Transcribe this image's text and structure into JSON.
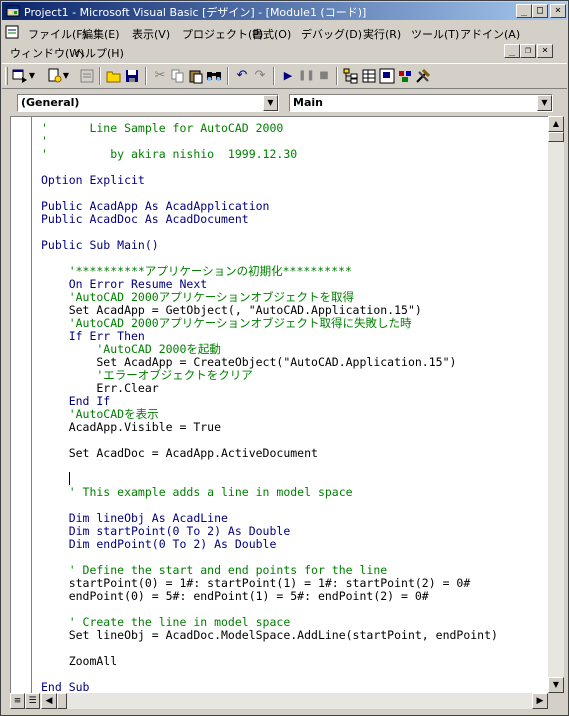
{
  "window": {
    "title": "Project1 - Microsoft Visual Basic [デザイン] - [Module1 (コード)]",
    "minimize_glyph": "_",
    "maximize_glyph": "□",
    "close_glyph": "×"
  },
  "menu": {
    "row1": [
      "ファイル(F)",
      "編集(E)",
      "表示(V)",
      "プロジェクト(P)",
      "書式(O)",
      "デバッグ(D)",
      "実行(R)",
      "ツール(T)",
      "アドイン(A)"
    ],
    "row2": [
      "ウィンドウ(W)",
      "ヘルプ(H)"
    ]
  },
  "combos": {
    "object": "(General)",
    "procedure": "Main"
  },
  "code": [
    {
      "text": "'      Line Sample for AutoCAD 2000",
      "kind": "cm"
    },
    {
      "text": "'",
      "kind": "cm"
    },
    {
      "text": "'         by akira nishio  1999.12.30",
      "kind": "cm"
    },
    {
      "text": "",
      "kind": "tx"
    },
    {
      "text": "Option Explicit",
      "kind": "kw"
    },
    {
      "text": "",
      "kind": "tx"
    },
    {
      "text": "Public AcadApp As AcadApplication",
      "kind": "kw"
    },
    {
      "text": "Public AcadDoc As AcadDocument",
      "kind": "kw"
    },
    {
      "text": "",
      "kind": "tx"
    },
    {
      "text": "Public Sub Main()",
      "kind": "kw"
    },
    {
      "text": "",
      "kind": "tx"
    },
    {
      "text": "    '**********アプリケーションの初期化**********",
      "kind": "cm"
    },
    {
      "text": "    On Error Resume Next",
      "kind": "kw"
    },
    {
      "text": "    'AutoCAD 2000アプリケーションオブジェクトを取得",
      "kind": "cm"
    },
    {
      "text": "    Set AcadApp = GetObject(, \"AutoCAD.Application.15\")",
      "kind": "tx"
    },
    {
      "text": "    'AutoCAD 2000アプリケーションオブジェクト取得に失敗した時",
      "kind": "cm"
    },
    {
      "text": "    If Err Then",
      "kind": "kw"
    },
    {
      "text": "        'AutoCAD 2000を起動",
      "kind": "cm"
    },
    {
      "text": "        Set AcadApp = CreateObject(\"AutoCAD.Application.15\")",
      "kind": "tx"
    },
    {
      "text": "        'エラーオブジェクトをクリア",
      "kind": "cm"
    },
    {
      "text": "        Err.Clear",
      "kind": "tx"
    },
    {
      "text": "    End If",
      "kind": "kw"
    },
    {
      "text": "    'AutoCADを表示",
      "kind": "cm"
    },
    {
      "text": "    AcadApp.Visible = True",
      "kind": "tx"
    },
    {
      "text": "",
      "kind": "tx"
    },
    {
      "text": "    Set AcadDoc = AcadApp.ActiveDocument",
      "kind": "tx"
    },
    {
      "text": "",
      "kind": "tx"
    },
    {
      "text": "",
      "kind": "tx"
    },
    {
      "text": "    ' This example adds a line in model space",
      "kind": "cm"
    },
    {
      "text": "",
      "kind": "tx"
    },
    {
      "text": "    Dim lineObj As AcadLine",
      "kind": "kw"
    },
    {
      "text": "    Dim startPoint(0 To 2) As Double",
      "kind": "kw"
    },
    {
      "text": "    Dim endPoint(0 To 2) As Double",
      "kind": "kw"
    },
    {
      "text": "",
      "kind": "tx"
    },
    {
      "text": "    ' Define the start and end points for the line",
      "kind": "cm"
    },
    {
      "text": "    startPoint(0) = 1#: startPoint(1) = 1#: startPoint(2) = 0#",
      "kind": "tx"
    },
    {
      "text": "    endPoint(0) = 5#: endPoint(1) = 5#: endPoint(2) = 0#",
      "kind": "tx"
    },
    {
      "text": "",
      "kind": "tx"
    },
    {
      "text": "    ' Create the line in model space",
      "kind": "cm"
    },
    {
      "text": "    Set lineObj = AcadDoc.ModelSpace.AddLine(startPoint, endPoint)",
      "kind": "tx"
    },
    {
      "text": "",
      "kind": "tx"
    },
    {
      "text": "    ZoomAll",
      "kind": "tx"
    },
    {
      "text": "",
      "kind": "tx"
    },
    {
      "text": "End Sub",
      "kind": "kw"
    }
  ]
}
